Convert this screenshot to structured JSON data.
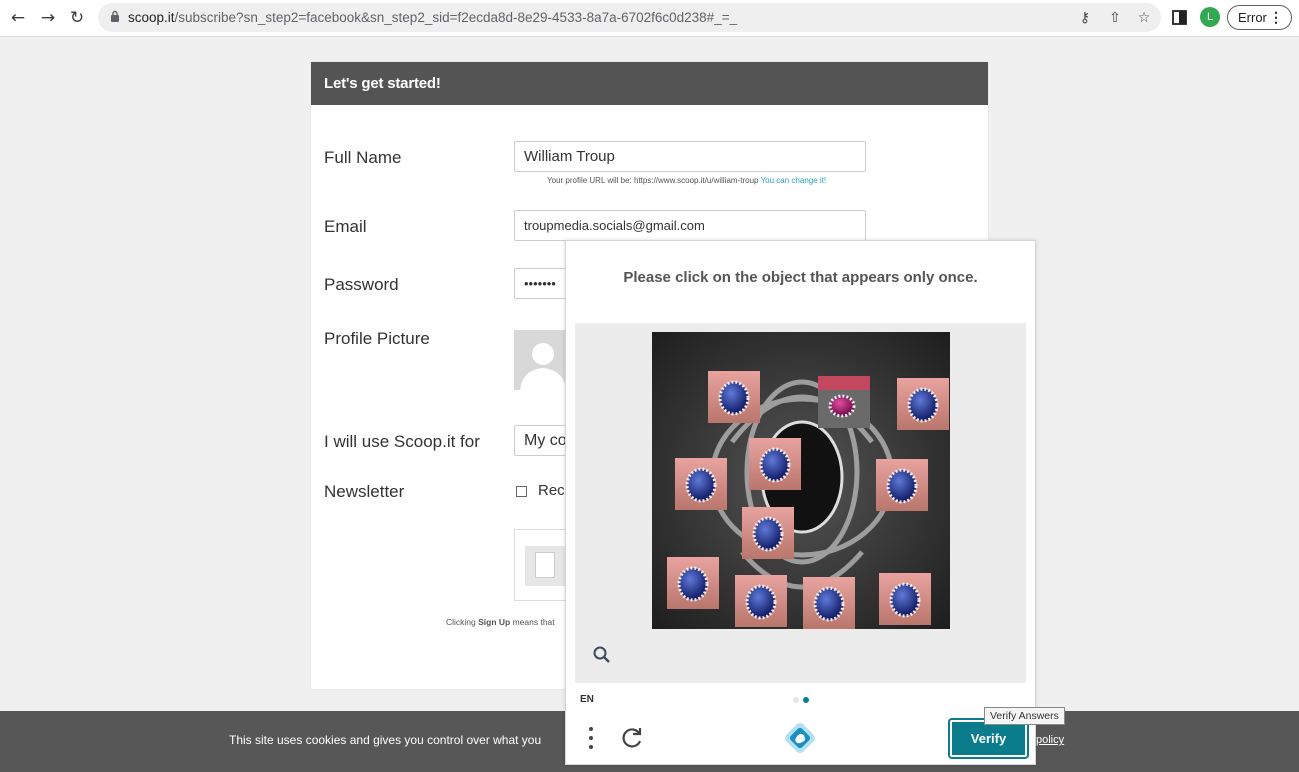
{
  "browser": {
    "url_host": "scoop.it",
    "url_path": "/subscribe?sn_step2=facebook&sn_step2_sid=f2ecda8d-8e29-4533-8a7a-6702f6c0d238#_=_",
    "profile_initial": "L",
    "error_label": "Error"
  },
  "form": {
    "header": "Let's get started!",
    "full_name_label": "Full Name",
    "full_name_value": "William Troup",
    "profile_url_hint": "Your profile URL will be: https://www.scoop.it/u/william-troup",
    "profile_url_change": "You can change it!",
    "email_label": "Email",
    "email_value": "troupmedia.socials@gmail.com",
    "password_label": "Password",
    "password_value": "•••••••",
    "profile_picture_label": "Profile Picture",
    "use_for_label": "I will use Scoop.it for",
    "use_for_value": "My co",
    "newsletter_label": "Newsletter",
    "newsletter_option": "Rec",
    "clicking_prefix": "Clicking ",
    "clicking_bold": "Sign Up",
    "clicking_suffix": " means that"
  },
  "cookie": {
    "text": "This site uses cookies and gives you control over what you",
    "link": "policy"
  },
  "captcha": {
    "prompt": "Please click on the object that appears only once.",
    "language": "EN",
    "verify_label": "Verify",
    "tooltip": "Verify Answers",
    "accent_color": "#0a7c8c"
  }
}
